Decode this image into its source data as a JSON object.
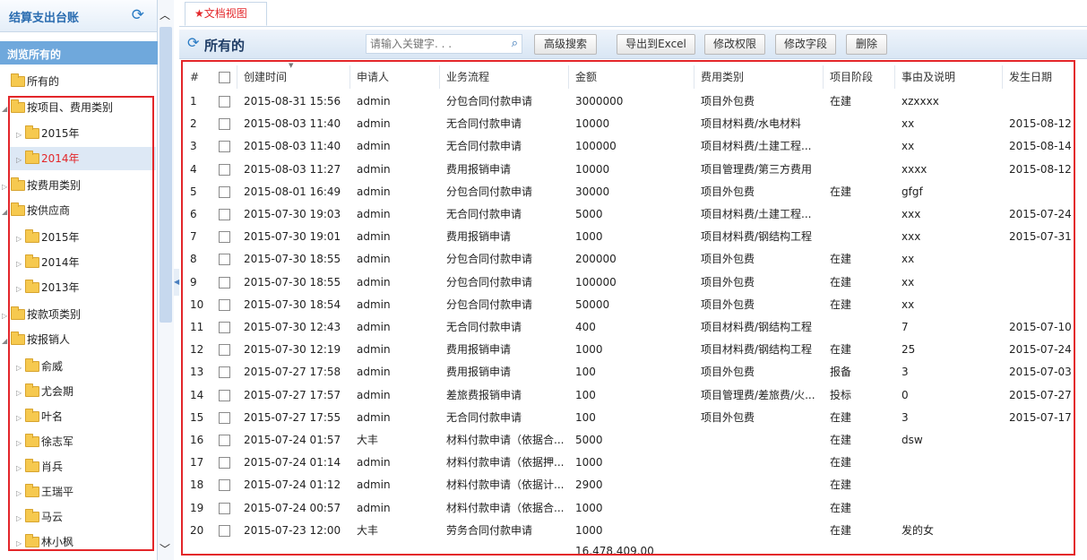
{
  "sidebar": {
    "title": "结算支出台账",
    "refresh_icon": "refresh-icon",
    "browse_label": "浏览所有的",
    "tree": [
      {
        "label": "所有的",
        "level": 0,
        "arrow": ""
      },
      {
        "label": "按项目、费用类别",
        "level": 0,
        "arrow": "◢"
      },
      {
        "label": "2015年",
        "level": 1,
        "arrow": "▷"
      },
      {
        "label": "2014年",
        "level": 1,
        "arrow": "▷",
        "selected": true
      },
      {
        "label": "按费用类别",
        "level": 0,
        "arrow": "▷"
      },
      {
        "label": "按供应商",
        "level": 0,
        "arrow": "◢"
      },
      {
        "label": "2015年",
        "level": 1,
        "arrow": "▷"
      },
      {
        "label": "2014年",
        "level": 1,
        "arrow": "▷"
      },
      {
        "label": "2013年",
        "level": 1,
        "arrow": "▷"
      },
      {
        "label": "按款项类别",
        "level": 0,
        "arrow": "▷"
      },
      {
        "label": "按报销人",
        "level": 0,
        "arrow": "◢"
      },
      {
        "label": "俞威",
        "level": 1,
        "arrow": "▷"
      },
      {
        "label": "尤会期",
        "level": 1,
        "arrow": "▷"
      },
      {
        "label": "叶名",
        "level": 1,
        "arrow": "▷"
      },
      {
        "label": "徐志军",
        "level": 1,
        "arrow": "▷"
      },
      {
        "label": "肖兵",
        "level": 1,
        "arrow": "▷"
      },
      {
        "label": "王瑞平",
        "level": 1,
        "arrow": "▷"
      },
      {
        "label": "马云",
        "level": 1,
        "arrow": "▷"
      },
      {
        "label": "林小枫",
        "level": 1,
        "arrow": "▷"
      }
    ]
  },
  "tab": {
    "label": "★文档视图"
  },
  "toolbar": {
    "title": "所有的",
    "search_placeholder": "请输入关键字. . .",
    "search_icon": "search-icon",
    "buttons": [
      "高级搜索",
      "导出到Excel",
      "修改权限",
      "修改字段",
      "删除"
    ]
  },
  "table": {
    "columns": [
      "#",
      "",
      "创建时间",
      "申请人",
      "业务流程",
      "金额",
      "费用类别",
      "项目阶段",
      "事由及说明",
      "发生日期"
    ],
    "rows": [
      [
        "1",
        "",
        "2015-08-31 15:56",
        "admin",
        "分包合同付款申请",
        "3000000",
        "项目外包费",
        "在建",
        "xzxxxx",
        ""
      ],
      [
        "2",
        "",
        "2015-08-03 11:40",
        "admin",
        "无合同付款申请",
        "10000",
        "项目材料费/水电材料",
        "",
        "xx",
        "2015-08-12"
      ],
      [
        "3",
        "",
        "2015-08-03 11:40",
        "admin",
        "无合同付款申请",
        "100000",
        "项目材料费/土建工程...",
        "",
        "xx",
        "2015-08-14"
      ],
      [
        "4",
        "",
        "2015-08-03 11:27",
        "admin",
        "费用报销申请",
        "10000",
        "项目管理费/第三方费用",
        "",
        "xxxx",
        "2015-08-12"
      ],
      [
        "5",
        "",
        "2015-08-01 16:49",
        "admin",
        "分包合同付款申请",
        "30000",
        "项目外包费",
        "在建",
        "gfgf",
        ""
      ],
      [
        "6",
        "",
        "2015-07-30 19:03",
        "admin",
        "无合同付款申请",
        "5000",
        "项目材料费/土建工程...",
        "",
        "xxx",
        "2015-07-24"
      ],
      [
        "7",
        "",
        "2015-07-30 19:01",
        "admin",
        "费用报销申请",
        "1000",
        "项目材料费/钢结构工程",
        "",
        "xxx",
        "2015-07-31"
      ],
      [
        "8",
        "",
        "2015-07-30 18:55",
        "admin",
        "分包合同付款申请",
        "200000",
        "项目外包费",
        "在建",
        "xx",
        ""
      ],
      [
        "9",
        "",
        "2015-07-30 18:55",
        "admin",
        "分包合同付款申请",
        "100000",
        "项目外包费",
        "在建",
        "xx",
        ""
      ],
      [
        "10",
        "",
        "2015-07-30 18:54",
        "admin",
        "分包合同付款申请",
        "50000",
        "项目外包费",
        "在建",
        "xx",
        ""
      ],
      [
        "11",
        "",
        "2015-07-30 12:43",
        "admin",
        "无合同付款申请",
        "400",
        "项目材料费/钢结构工程",
        "",
        "7",
        "2015-07-10"
      ],
      [
        "12",
        "",
        "2015-07-30 12:19",
        "admin",
        "费用报销申请",
        "1000",
        "项目材料费/钢结构工程",
        "在建",
        "25",
        "2015-07-24"
      ],
      [
        "13",
        "",
        "2015-07-27 17:58",
        "admin",
        "费用报销申请",
        "100",
        "项目外包费",
        "报备",
        "3",
        "2015-07-03"
      ],
      [
        "14",
        "",
        "2015-07-27 17:57",
        "admin",
        "差旅费报销申请",
        "100",
        "项目管理费/差旅费/火...",
        "投标",
        "0",
        "2015-07-27"
      ],
      [
        "15",
        "",
        "2015-07-27 17:55",
        "admin",
        "无合同付款申请",
        "100",
        "项目外包费",
        "在建",
        "3",
        "2015-07-17"
      ],
      [
        "16",
        "",
        "2015-07-24 01:57",
        "大丰",
        "材料付款申请（依据合...",
        "5000",
        "",
        "在建",
        "dsw",
        ""
      ],
      [
        "17",
        "",
        "2015-07-24 01:14",
        "admin",
        "材料付款申请（依据押...",
        "1000",
        "",
        "在建",
        "",
        ""
      ],
      [
        "18",
        "",
        "2015-07-24 01:12",
        "admin",
        "材料付款申请（依据计...",
        "2900",
        "",
        "在建",
        "",
        ""
      ],
      [
        "19",
        "",
        "2015-07-24 00:57",
        "admin",
        "材料付款申请（依据合...",
        "1000",
        "",
        "在建",
        "",
        ""
      ],
      [
        "20",
        "",
        "2015-07-23 12:00",
        "大丰",
        "劳务合同付款申请",
        "1000",
        "",
        "在建",
        "发的女",
        ""
      ]
    ],
    "total_amount": "16,478,409.00"
  }
}
